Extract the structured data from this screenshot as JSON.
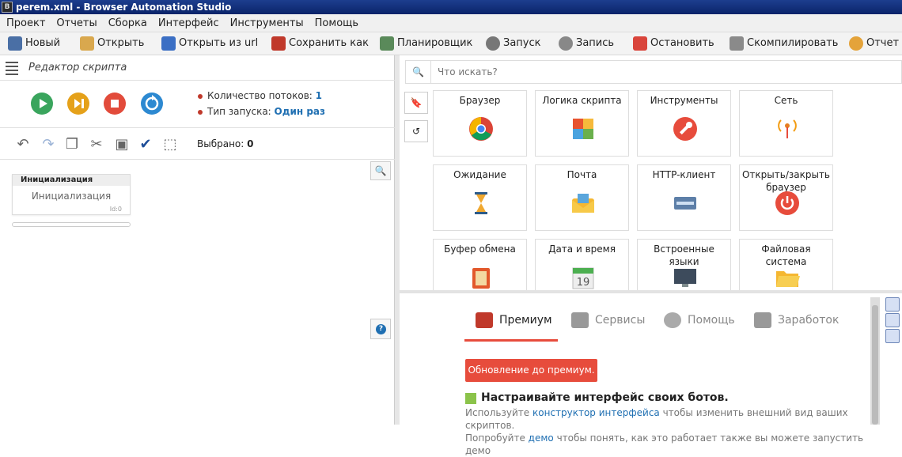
{
  "window": {
    "title": "perem.xml - Browser Automation Studio"
  },
  "menu": [
    "Проект",
    "Отчеты",
    "Сборка",
    "Интерфейс",
    "Инструменты",
    "Помощь"
  ],
  "toolbar": [
    {
      "label": "Новый",
      "icon": "new-file-icon",
      "color": "#4a6fa5"
    },
    {
      "label": "Открыть",
      "icon": "folder-icon",
      "color": "#d9a84e"
    },
    {
      "label": "Открыть из url",
      "icon": "download-arrow-icon",
      "color": "#3b6fc4"
    },
    {
      "label": "Сохранить как",
      "icon": "save-icon",
      "color": "#c0392b"
    },
    {
      "label": "Планировщик",
      "icon": "calendar-icon",
      "color": "#5a8a5a"
    },
    {
      "label": "Запуск",
      "icon": "play-icon",
      "color": "#777777"
    },
    {
      "label": "Запись",
      "icon": "record-icon",
      "color": "#888888"
    },
    {
      "label": "Остановить",
      "icon": "stop-icon",
      "color": "#d9443b"
    },
    {
      "label": "Скомпилировать",
      "icon": "box-icon",
      "color": "#8a8a8a"
    },
    {
      "label": "Отчет о",
      "icon": "pie-chart-icon",
      "color": "#e4a33a"
    }
  ],
  "editor": {
    "title": "Редактор скрипта",
    "threads_label": "Количество потоков:",
    "threads_value": "1",
    "launch_label": "Тип запуска:",
    "launch_value": "Один раз",
    "selected_label": "Выбрано:",
    "selected_value": "0",
    "block": {
      "header": "Инициализация",
      "body": "Инициализация",
      "id": "Id:0"
    }
  },
  "search": {
    "placeholder": "Что искать?"
  },
  "actions": [
    {
      "label": "Браузер",
      "icon": "chrome-icon"
    },
    {
      "label": "Логика скрипта",
      "icon": "puzzle-icon"
    },
    {
      "label": "Инструменты",
      "icon": "wrench-icon"
    },
    {
      "label": "Сеть",
      "icon": "antenna-icon"
    },
    {
      "label": "Ожидание",
      "icon": "hourglass-icon"
    },
    {
      "label": "Почта",
      "icon": "mail-icon"
    },
    {
      "label": "HTTP-клиент",
      "icon": "http-icon"
    },
    {
      "label": "Открыть/закрыть браузер",
      "icon": "power-icon"
    },
    {
      "label": "Буфер обмена",
      "icon": "clipboard-icon"
    },
    {
      "label": "Дата и время",
      "icon": "calendar-19-icon"
    },
    {
      "label": "Встроенные языки",
      "icon": "monitor-code-icon"
    },
    {
      "label": "Файловая система",
      "icon": "folder-icon"
    }
  ],
  "tabs": [
    {
      "label": "Премиум",
      "icon": "certificate-icon",
      "active": true
    },
    {
      "label": "Сервисы",
      "icon": "keyboard-icon",
      "active": false
    },
    {
      "label": "Помощь",
      "icon": "lifebuoy-icon",
      "active": false
    },
    {
      "label": "Заработок",
      "icon": "money-screen-icon",
      "active": false
    }
  ],
  "promo": {
    "button": "Обновление до премиум.",
    "title": "Настраивайте интерфейс своих ботов.",
    "text_before": "Используйте ",
    "link": "конструктор интерфейса",
    "text_after": " чтобы изменить внешний вид ваших скриптов.",
    "line2_before": "Попробуйте ",
    "line2_link": "демо",
    "line2_after": " чтобы понять, как это работает также вы можете запустить демо"
  }
}
